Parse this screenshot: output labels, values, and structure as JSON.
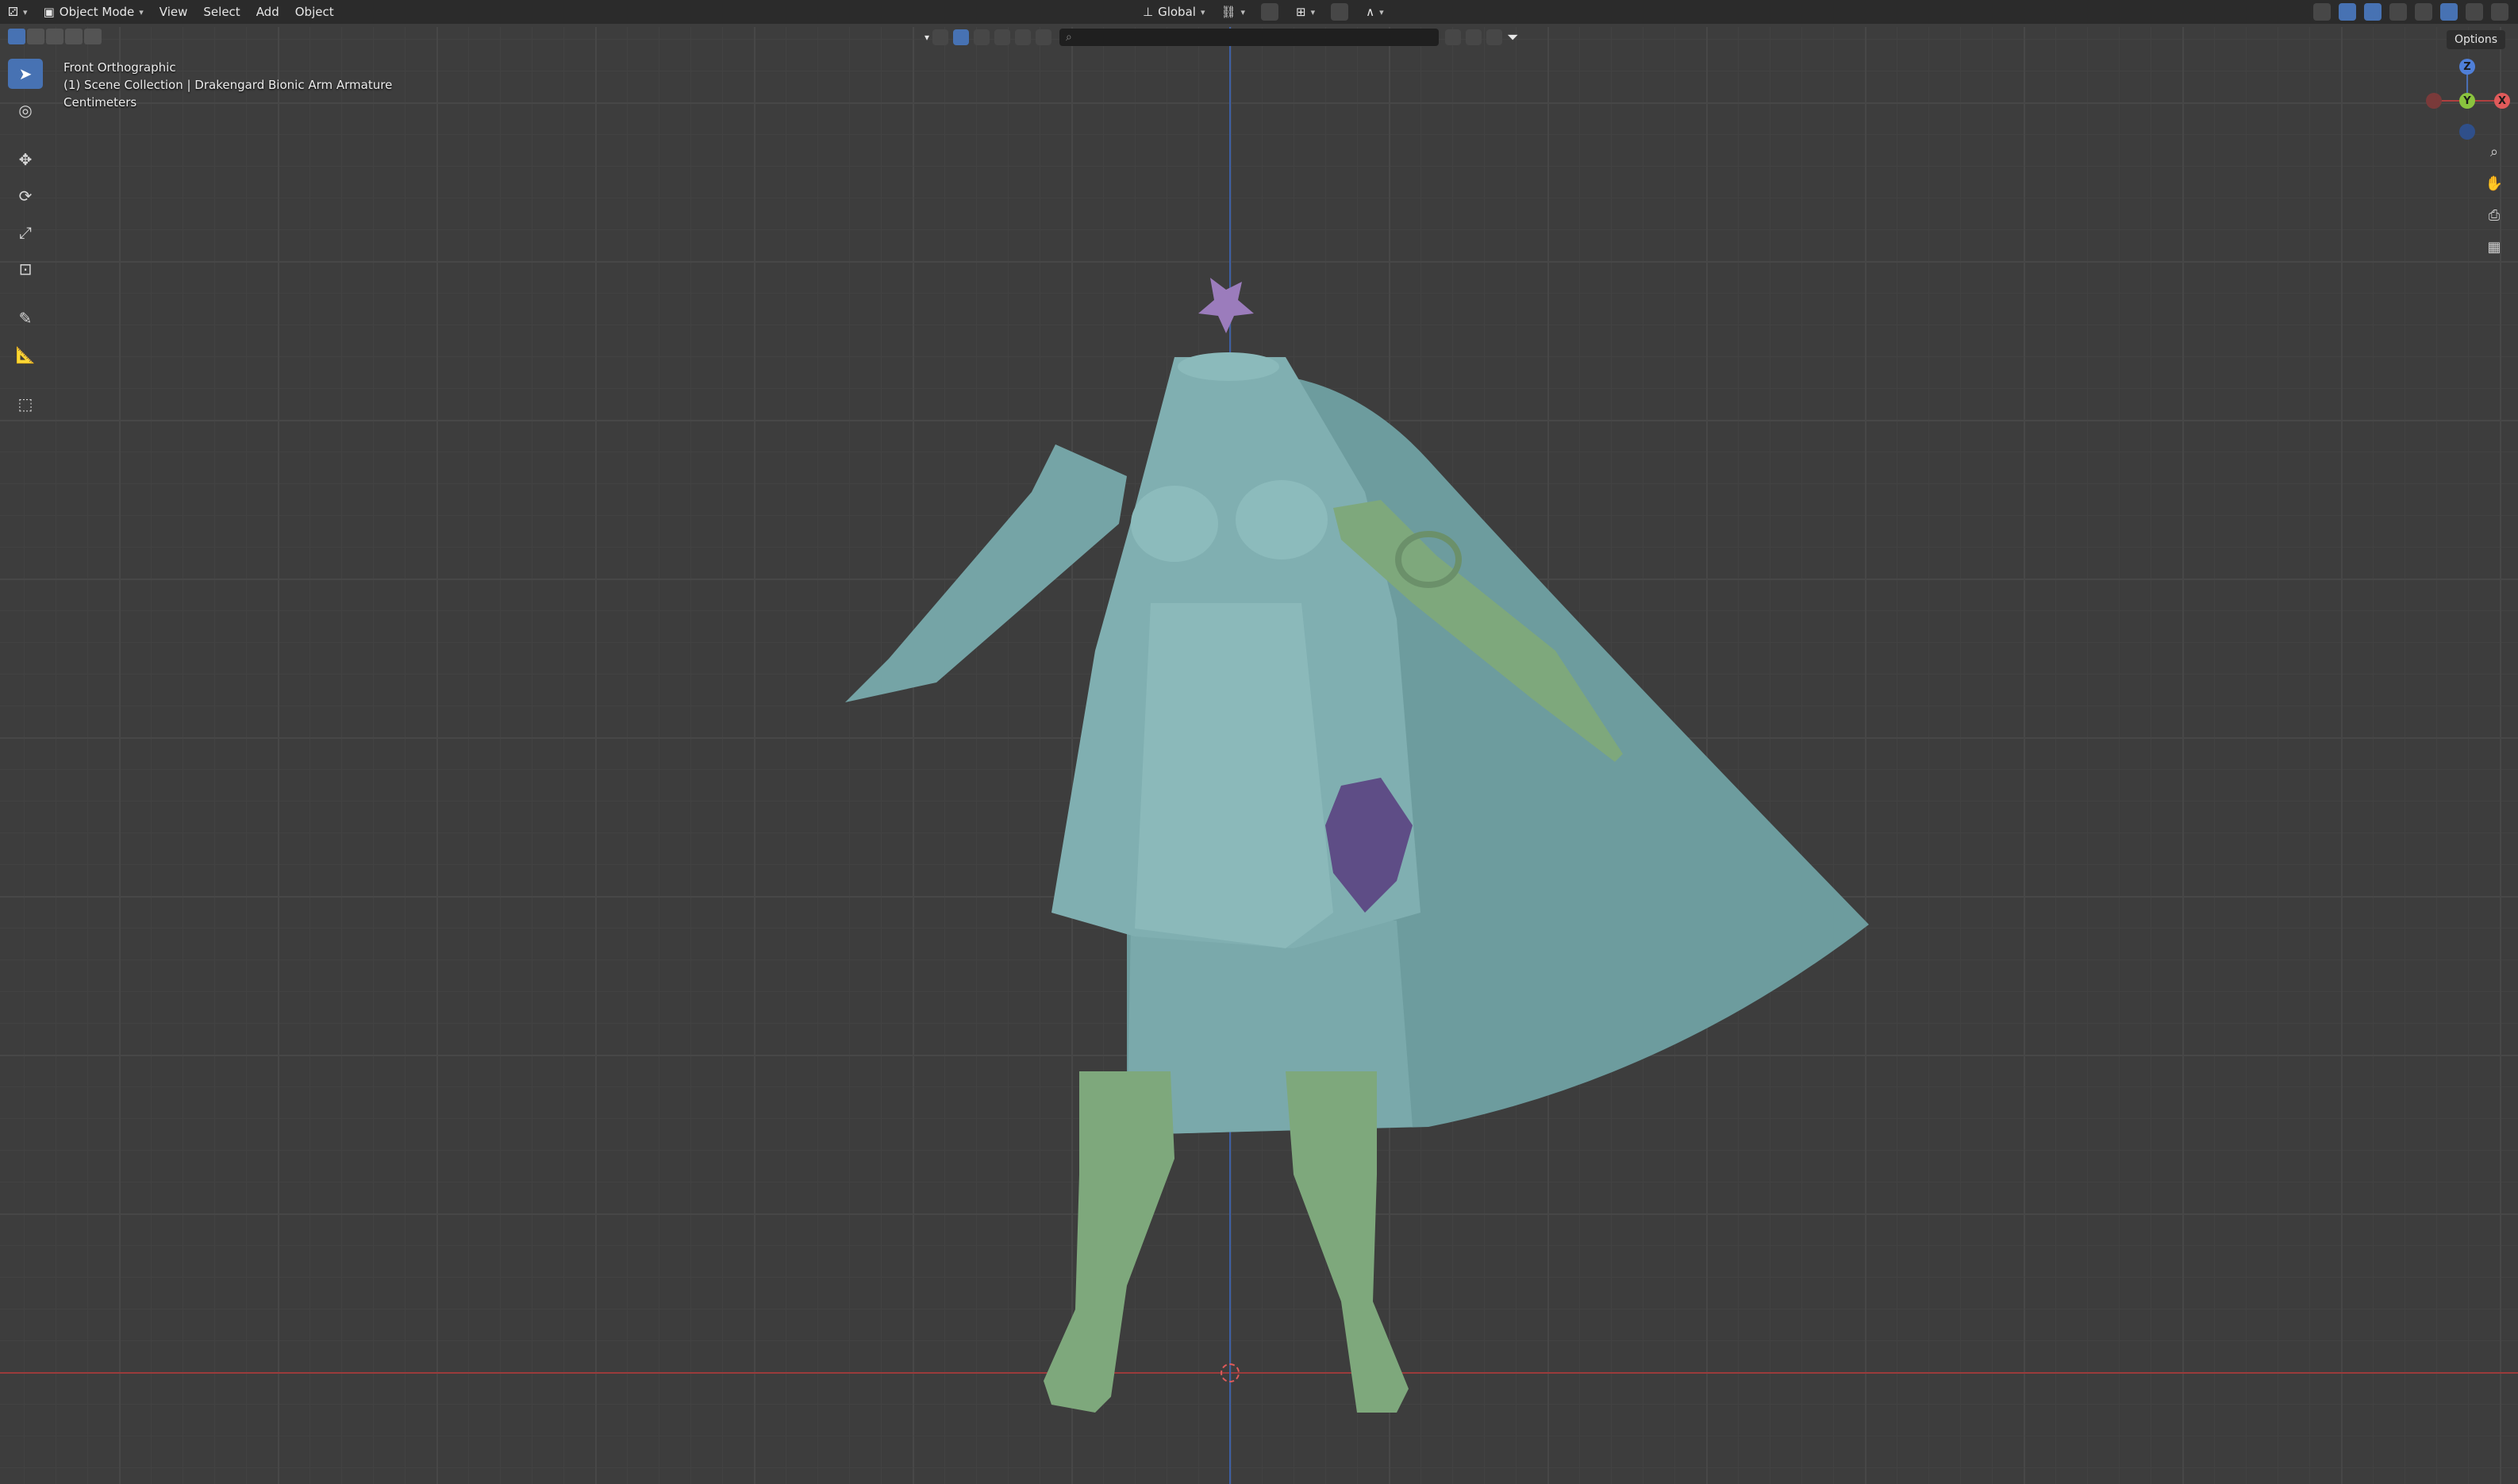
{
  "header": {
    "mode": "Object Mode",
    "menus": [
      "View",
      "Select",
      "Add",
      "Object"
    ],
    "transform_orientation": "Global"
  },
  "overlay": {
    "view_name": "Front Orthographic",
    "collection": "(1) Scene Collection | Drakengard Bionic Arm Armature",
    "units": "Centimeters"
  },
  "options_label": "Options",
  "gizmo": {
    "z": "Z",
    "y": "Y",
    "x": "X"
  },
  "icons": {
    "select": "cursor-select-icon",
    "cursor": "3d-cursor-icon",
    "move": "move-icon",
    "rotate": "rotate-icon",
    "scale": "scale-icon",
    "transform": "transform-icon",
    "annotate": "annotate-pencil-icon",
    "measure": "measure-icon",
    "add_cube": "add-cube-icon"
  },
  "colors": {
    "cloth": "#7ba9ab",
    "armor": "#7fa37e",
    "flower": "#9a7bb8",
    "accent": "#4772b3"
  }
}
